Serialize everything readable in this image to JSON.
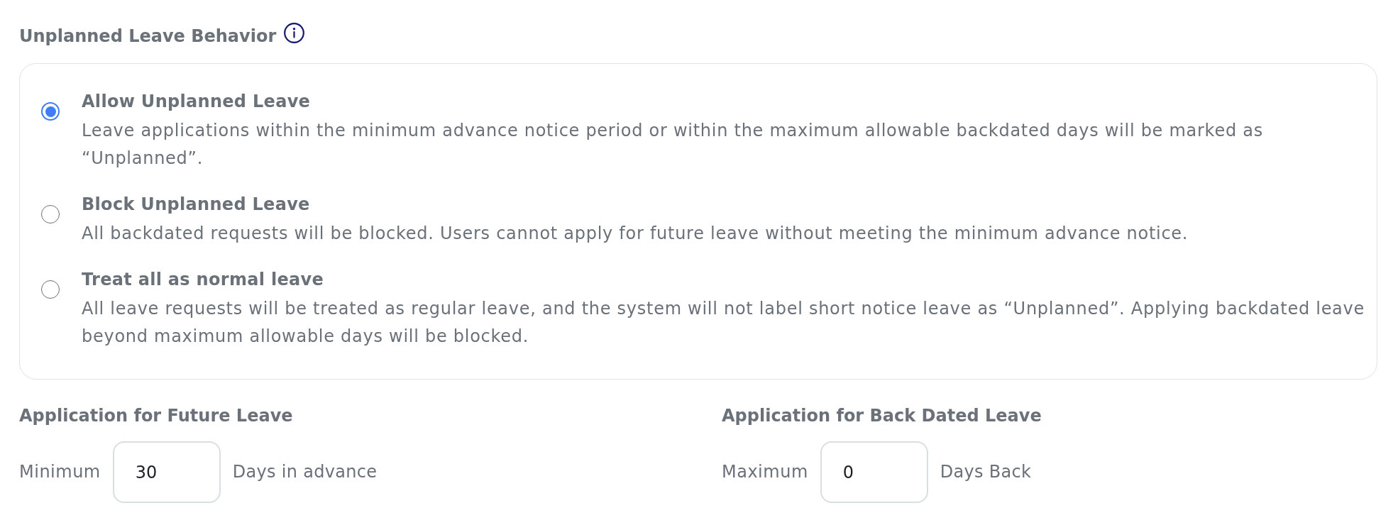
{
  "section": {
    "title": "Unplanned Leave Behavior"
  },
  "options": [
    {
      "title": "Allow Unplanned Leave",
      "description": "Leave applications within the minimum advance notice period or within the maximum allowable backdated days will be marked as “Unplanned”.",
      "selected": true
    },
    {
      "title": "Block Unplanned Leave",
      "description": "All backdated requests will be blocked. Users cannot apply for future leave without meeting the minimum advance notice.",
      "selected": false
    },
    {
      "title": "Treat all as normal leave",
      "description": "All leave requests will be treated as regular leave, and the system will not label short notice leave as “Unplanned”. Applying backdated leave beyond maximum allowable days will be blocked.",
      "selected": false
    }
  ],
  "limits": [
    {
      "title": "Application for Future Leave",
      "prefix": "Minimum",
      "value": "30",
      "suffix": "Days in advance"
    },
    {
      "title": "Application for Back Dated Leave",
      "prefix": "Maximum",
      "value": "0",
      "suffix": "Days Back"
    }
  ]
}
